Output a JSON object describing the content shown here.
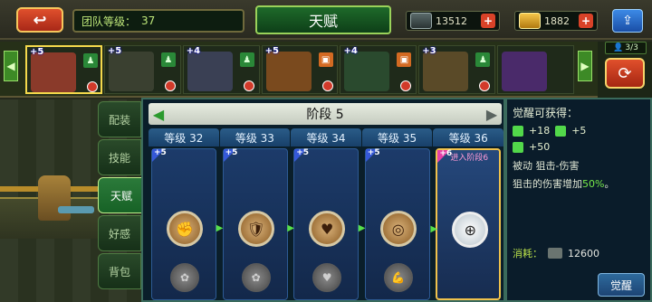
{
  "topbar": {
    "back_icon": "back-arrow-icon",
    "team_level_label": "团队等级：",
    "team_level_value": "37",
    "title": "天赋",
    "resources": [
      {
        "name": "silver-ingot-icon",
        "value": "13512"
      },
      {
        "name": "gold-ingot-icon",
        "value": "1882"
      }
    ],
    "share_icon": "share-icon"
  },
  "heroes": [
    {
      "stars": "+5",
      "tag": "person",
      "selected": true,
      "color": "#8a3a2a"
    },
    {
      "stars": "+5",
      "tag": "person",
      "selected": false,
      "color": "#3a4030"
    },
    {
      "stars": "+4",
      "tag": "person",
      "selected": false,
      "color": "#3a4054"
    },
    {
      "stars": "+5",
      "tag": "orange",
      "selected": false,
      "color": "#7a4a1e"
    },
    {
      "stars": "+4",
      "tag": "orange",
      "selected": false,
      "color": "#2a4a2e"
    },
    {
      "stars": "+3",
      "tag": "person",
      "selected": false,
      "color": "#5a4a28"
    },
    {
      "stars": "",
      "tag": "",
      "selected": false,
      "color": "#4a2a6a"
    }
  ],
  "slots": {
    "count": "3/3"
  },
  "side_tabs": [
    {
      "label": "配装",
      "active": false
    },
    {
      "label": "技能",
      "active": false
    },
    {
      "label": "天赋",
      "active": true
    },
    {
      "label": "好感",
      "active": false
    },
    {
      "label": "背包",
      "active": false
    }
  ],
  "stage": {
    "label": "阶段 5"
  },
  "columns": [
    {
      "level": "等级 32",
      "plus": "+5",
      "active": false,
      "icon": "fist-icon",
      "icon2": "gear-icon",
      "advance": ""
    },
    {
      "level": "等级 33",
      "plus": "+5",
      "active": false,
      "icon": "shield-icon",
      "icon2": "gear-icon",
      "advance": ""
    },
    {
      "level": "等级 34",
      "plus": "+5",
      "active": false,
      "icon": "heart-icon",
      "icon2": "heart-icon",
      "advance": ""
    },
    {
      "level": "等级 35",
      "plus": "+5",
      "active": false,
      "icon": "target-icon",
      "icon2": "arm-icon",
      "advance": ""
    },
    {
      "level": "等级 36",
      "plus": "+6",
      "active": true,
      "icon": "crosshair-icon",
      "icon2": "",
      "advance": "进入阶段6"
    }
  ],
  "info": {
    "title": "觉醒可获得：",
    "stat1": "+18",
    "stat2": "+5",
    "stat3": "+50",
    "passive": "被动 狙击-伤害",
    "desc_prefix": "狙击的伤害增加",
    "desc_value": "50%",
    "desc_suffix": "。",
    "cost_label": "消耗：",
    "cost_value": "12600",
    "awaken_button": "觉醒"
  }
}
